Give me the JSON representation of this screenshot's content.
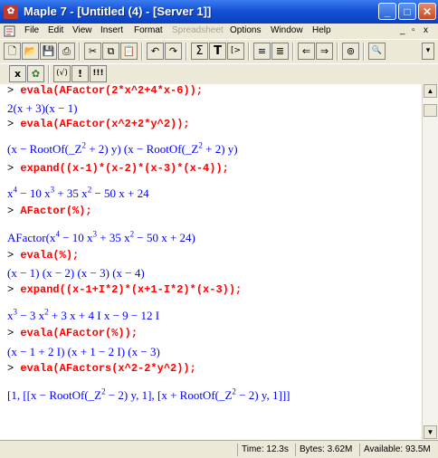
{
  "window": {
    "title": "Maple 7 - [Untitled (4) - [Server 1]]",
    "app_icon": "maple-leaf-icon",
    "buttons": [
      "minimize-icon",
      "maximize-icon",
      "close-icon"
    ]
  },
  "menubar": {
    "items": [
      {
        "label": "File",
        "disabled": false
      },
      {
        "label": "Edit",
        "disabled": false
      },
      {
        "label": "View",
        "disabled": false
      },
      {
        "label": "Insert",
        "disabled": false
      },
      {
        "label": "Format",
        "disabled": false
      },
      {
        "label": "Spreadsheet",
        "disabled": true
      },
      {
        "label": "Options",
        "disabled": false
      },
      {
        "label": "Window",
        "disabled": false
      },
      {
        "label": "Help",
        "disabled": false
      }
    ],
    "mdi_minimize": "_",
    "mdi_restore": "▫",
    "mdi_close": "x"
  },
  "toolbar": {
    "buttons": [
      {
        "name": "new-icon",
        "glyph": "🗋"
      },
      {
        "name": "open-icon",
        "glyph": "📂"
      },
      {
        "name": "save-icon",
        "glyph": "💾"
      },
      {
        "name": "print-icon",
        "glyph": "⎙"
      },
      {
        "name": "cut-icon",
        "glyph": "✂"
      },
      {
        "name": "copy-icon",
        "glyph": "⧉"
      },
      {
        "name": "paste-icon",
        "glyph": "📋"
      },
      {
        "name": "undo-icon",
        "glyph": "↶"
      },
      {
        "name": "redo-icon",
        "glyph": "↷"
      },
      {
        "name": "sum-icon",
        "glyph": "Σ"
      },
      {
        "name": "text-icon",
        "glyph": "T"
      },
      {
        "name": "prompt-icon",
        "glyph": "[>"
      },
      {
        "name": "indent-icon",
        "glyph": "≡"
      },
      {
        "name": "outdent-icon",
        "glyph": "≣"
      },
      {
        "name": "back-icon",
        "glyph": "⇐"
      },
      {
        "name": "forward-icon",
        "glyph": "⇒"
      },
      {
        "name": "stop-icon",
        "glyph": "⊚"
      },
      {
        "name": "magnify-icon",
        "glyph": "🔍"
      }
    ],
    "dropdown": "▾"
  },
  "context_toolbar": {
    "buttons": [
      {
        "name": "maple-input-icon",
        "glyph": "x"
      },
      {
        "name": "maple-leaf-tool-icon",
        "glyph": "✿"
      },
      {
        "name": "checkmark-icon",
        "glyph": "(√)"
      },
      {
        "name": "execute-icon",
        "glyph": "!"
      },
      {
        "name": "execute-all-icon",
        "glyph": "!!!"
      }
    ]
  },
  "document": {
    "prompt": ">",
    "lines": [
      {
        "type": "input",
        "text": "evala(AFactor(2*x^2+4*x-6));"
      },
      {
        "type": "output",
        "html": "2(x + 3)(x − 1)"
      },
      {
        "type": "input",
        "text": "evala(AFactor(x^2+2*y^2));"
      },
      {
        "type": "output",
        "html": "(x − RootOf(_Z<sup>2</sup> + 2) y) (x − RootOf(_Z<sup>2</sup> + 2) y)"
      },
      {
        "type": "input",
        "text": "expand((x-1)*(x-2)*(x-3)*(x-4));"
      },
      {
        "type": "output",
        "html": "x<sup>4</sup> − 10 x<sup>3</sup> + 35 x<sup>2</sup> − 50 x + 24"
      },
      {
        "type": "input",
        "text": "AFactor(%);"
      },
      {
        "type": "output",
        "html": "AFactor(x<sup>4</sup> − 10 x<sup>3</sup> + 35 x<sup>2</sup> − 50 x + 24)"
      },
      {
        "type": "input",
        "text": "evala(%);"
      },
      {
        "type": "output",
        "html": "(x − 1) (x − 2) (x − 3) (x − 4)"
      },
      {
        "type": "input",
        "text": "expand((x-1+I*2)*(x+1-I*2)*(x-3));"
      },
      {
        "type": "output",
        "html": "x<sup>3</sup> − 3 x<sup>2</sup> + 3 x + 4 I x − 9 − 12 I"
      },
      {
        "type": "input",
        "text": "evala(AFactor(%));"
      },
      {
        "type": "output",
        "html": "(x − 1 + 2 I) (x + 1 − 2 I) (x − 3)"
      },
      {
        "type": "input",
        "text": "evala(AFactors(x^2-2*y^2));"
      },
      {
        "type": "output",
        "html": "[1, [[x − RootOf(_Z<sup>2</sup> − 2) y, 1], [x + RootOf(_Z<sup>2</sup> − 2) y, 1]]]"
      }
    ]
  },
  "statusbar": {
    "time": "Time: 12.3s",
    "bytes": "Bytes: 3.62M",
    "available": "Available: 93.5M"
  }
}
